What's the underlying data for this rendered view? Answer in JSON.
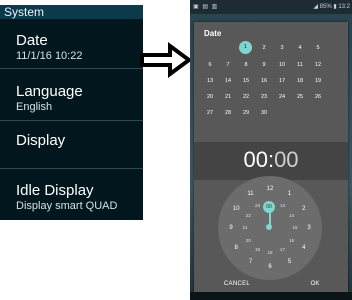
{
  "settings": {
    "header": "System",
    "items": [
      {
        "title": "Date",
        "subtitle": "11/1/16 10:22"
      },
      {
        "title": "Language",
        "subtitle": "English"
      },
      {
        "title": "Display",
        "subtitle": ""
      },
      {
        "title": "Idle Display",
        "subtitle": "Display smart QUAD"
      }
    ]
  },
  "arrow_icon": "right-arrow",
  "phone": {
    "status_right": "◢ 85% ▮ 13:2",
    "dialog": {
      "title": "Date",
      "calendar_rows": [
        [
          "",
          "",
          "1",
          "2",
          "3",
          "4",
          "5"
        ],
        [
          "6",
          "7",
          "8",
          "9",
          "10",
          "11",
          "12"
        ],
        [
          "13",
          "14",
          "15",
          "16",
          "17",
          "18",
          "19"
        ],
        [
          "20",
          "21",
          "22",
          "23",
          "24",
          "25",
          "26"
        ],
        [
          "27",
          "28",
          "29",
          "30",
          "",
          "",
          ""
        ]
      ],
      "selected_day": "1",
      "time": {
        "hours": "00",
        "colon": ":",
        "minutes": "00"
      },
      "clock_outer": [
        "12",
        "1",
        "2",
        "3",
        "4",
        "5",
        "6",
        "7",
        "8",
        "9",
        "10",
        "11"
      ],
      "clock_inner": [
        "00",
        "13",
        "14",
        "15",
        "16",
        "17",
        "18",
        "19",
        "20",
        "21",
        "22",
        "23"
      ],
      "cancel_label": "CANCEL",
      "ok_label": "OK"
    }
  },
  "colors": {
    "accent": "#7fd6cf",
    "settings_bg": "#02161e",
    "dialog_bg": "#585858"
  }
}
